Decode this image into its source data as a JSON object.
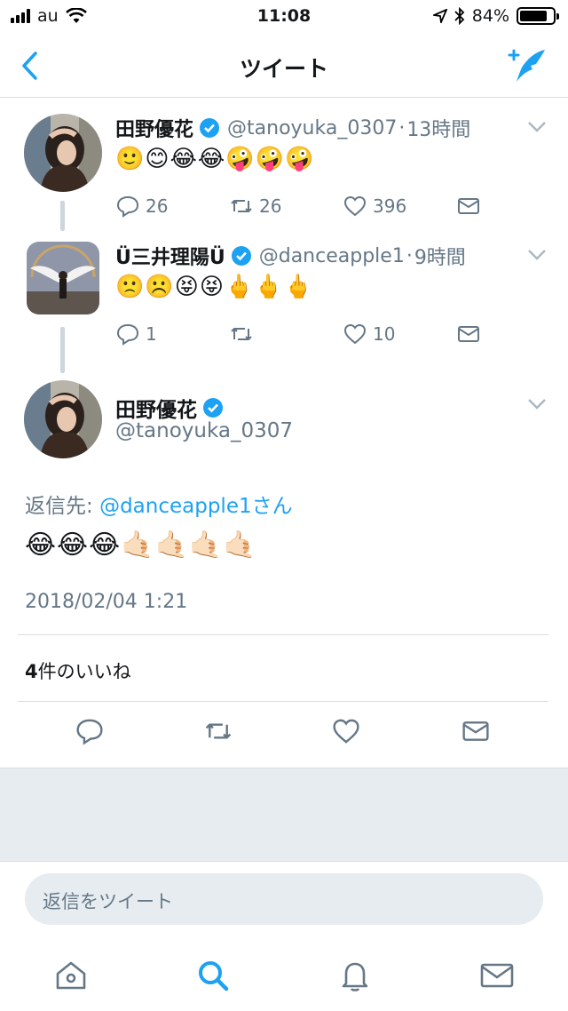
{
  "status": {
    "carrier": "au",
    "time": "11:08",
    "battery": "84%",
    "battery_level": 0.84
  },
  "nav": {
    "title": "ツイート"
  },
  "tweets": [
    {
      "name": "田野優花",
      "handle": "@tanoyuka_0307",
      "time": "13時間",
      "text": "🙂😊😂😂🤪🤪🤪",
      "replies": "26",
      "retweets": "26",
      "likes": "396"
    },
    {
      "name": "Ü三井理陽Ü",
      "handle": "@danceapple1",
      "time": "9時間",
      "text": "🙁☹️😝😝🖕🖕🖕",
      "replies": "1",
      "retweets": "",
      "likes": "10"
    }
  ],
  "main": {
    "name": "田野優花",
    "handle": "@tanoyuka_0307",
    "reply_prefix": "返信先: ",
    "reply_target": "@danceapple1さん",
    "text": "😂😂😂🤙🏻🤙🏻🤙🏻🤙🏻",
    "date": "2018/02/04 1:21",
    "likes_count": "4",
    "likes_suffix": "件のいいね"
  },
  "reply_placeholder": "返信をツイート",
  "colors": {
    "accent": "#1da1f2",
    "muted": "#657786",
    "divider": "#d8dde2",
    "bg_gray": "#e6ecf0"
  },
  "icons": [
    "back-icon",
    "compose-icon",
    "verified-icon",
    "reply-icon",
    "retweet-icon",
    "like-icon",
    "dm-icon",
    "home-icon",
    "search-icon",
    "notifications-icon",
    "messages-icon"
  ]
}
